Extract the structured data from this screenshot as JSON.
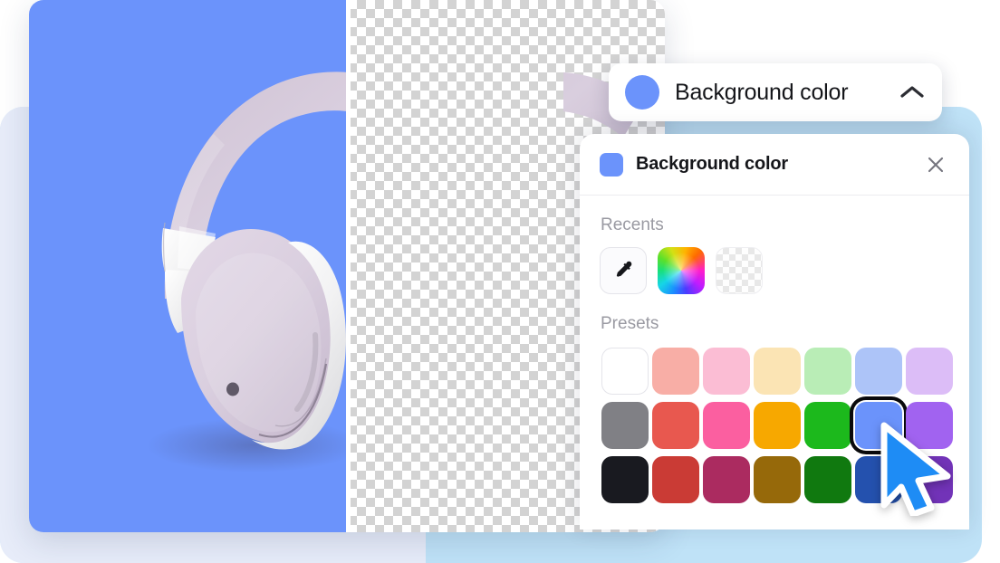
{
  "dropdown": {
    "label": "Background color",
    "swatch_color": "#6b93fb",
    "chevron_icon": "chevron-up-icon",
    "expanded": true
  },
  "panel": {
    "title": "Background color",
    "title_swatch_color": "#6b93fb",
    "close_icon": "close-icon",
    "sections": {
      "recents": {
        "label": "Recents",
        "items": [
          {
            "name": "eyedropper",
            "icon": "eyedropper-icon",
            "color": "#ffffff"
          },
          {
            "name": "color-wheel",
            "icon": "color-wheel-icon",
            "color": "rainbow"
          },
          {
            "name": "transparent",
            "icon": "transparent-icon",
            "color": "transparent"
          }
        ]
      },
      "presets": {
        "label": "Presets",
        "selected_index": 12,
        "rows": [
          [
            {
              "color": "#ffffff",
              "name": "white"
            },
            {
              "color": "#f8aea6",
              "name": "light-salmon"
            },
            {
              "color": "#fbbdd4",
              "name": "light-pink"
            },
            {
              "color": "#fbe4b4",
              "name": "light-yellow"
            },
            {
              "color": "#b9edb6",
              "name": "light-green"
            },
            {
              "color": "#adc4f8",
              "name": "light-blue"
            },
            {
              "color": "#dcbdf7",
              "name": "light-purple"
            }
          ],
          [
            {
              "color": "#808085",
              "name": "gray"
            },
            {
              "color": "#e8584f",
              "name": "red"
            },
            {
              "color": "#fb5fa0",
              "name": "pink"
            },
            {
              "color": "#f7a800",
              "name": "orange"
            },
            {
              "color": "#1cb91c",
              "name": "green"
            },
            {
              "color": "#6b93fb",
              "name": "blue"
            },
            {
              "color": "#a163f0",
              "name": "purple"
            }
          ],
          [
            {
              "color": "#191a20",
              "name": "black"
            },
            {
              "color": "#ca3b35",
              "name": "dark-red"
            },
            {
              "color": "#ab2b60",
              "name": "dark-magenta"
            },
            {
              "color": "#96690a",
              "name": "dark-gold"
            },
            {
              "color": "#10790f",
              "name": "dark-green"
            },
            {
              "color": "#2451ae",
              "name": "dark-blue"
            },
            {
              "color": "#7233b8",
              "name": "dark-purple"
            }
          ]
        ]
      }
    }
  },
  "canvas": {
    "left_background_color": "#6b93fb",
    "right_background": "transparent-checkerboard",
    "subject": "headphones",
    "divider": "before-after-split"
  },
  "cursor": {
    "icon": "mouse-pointer-icon",
    "color": "#1e8cf5"
  }
}
